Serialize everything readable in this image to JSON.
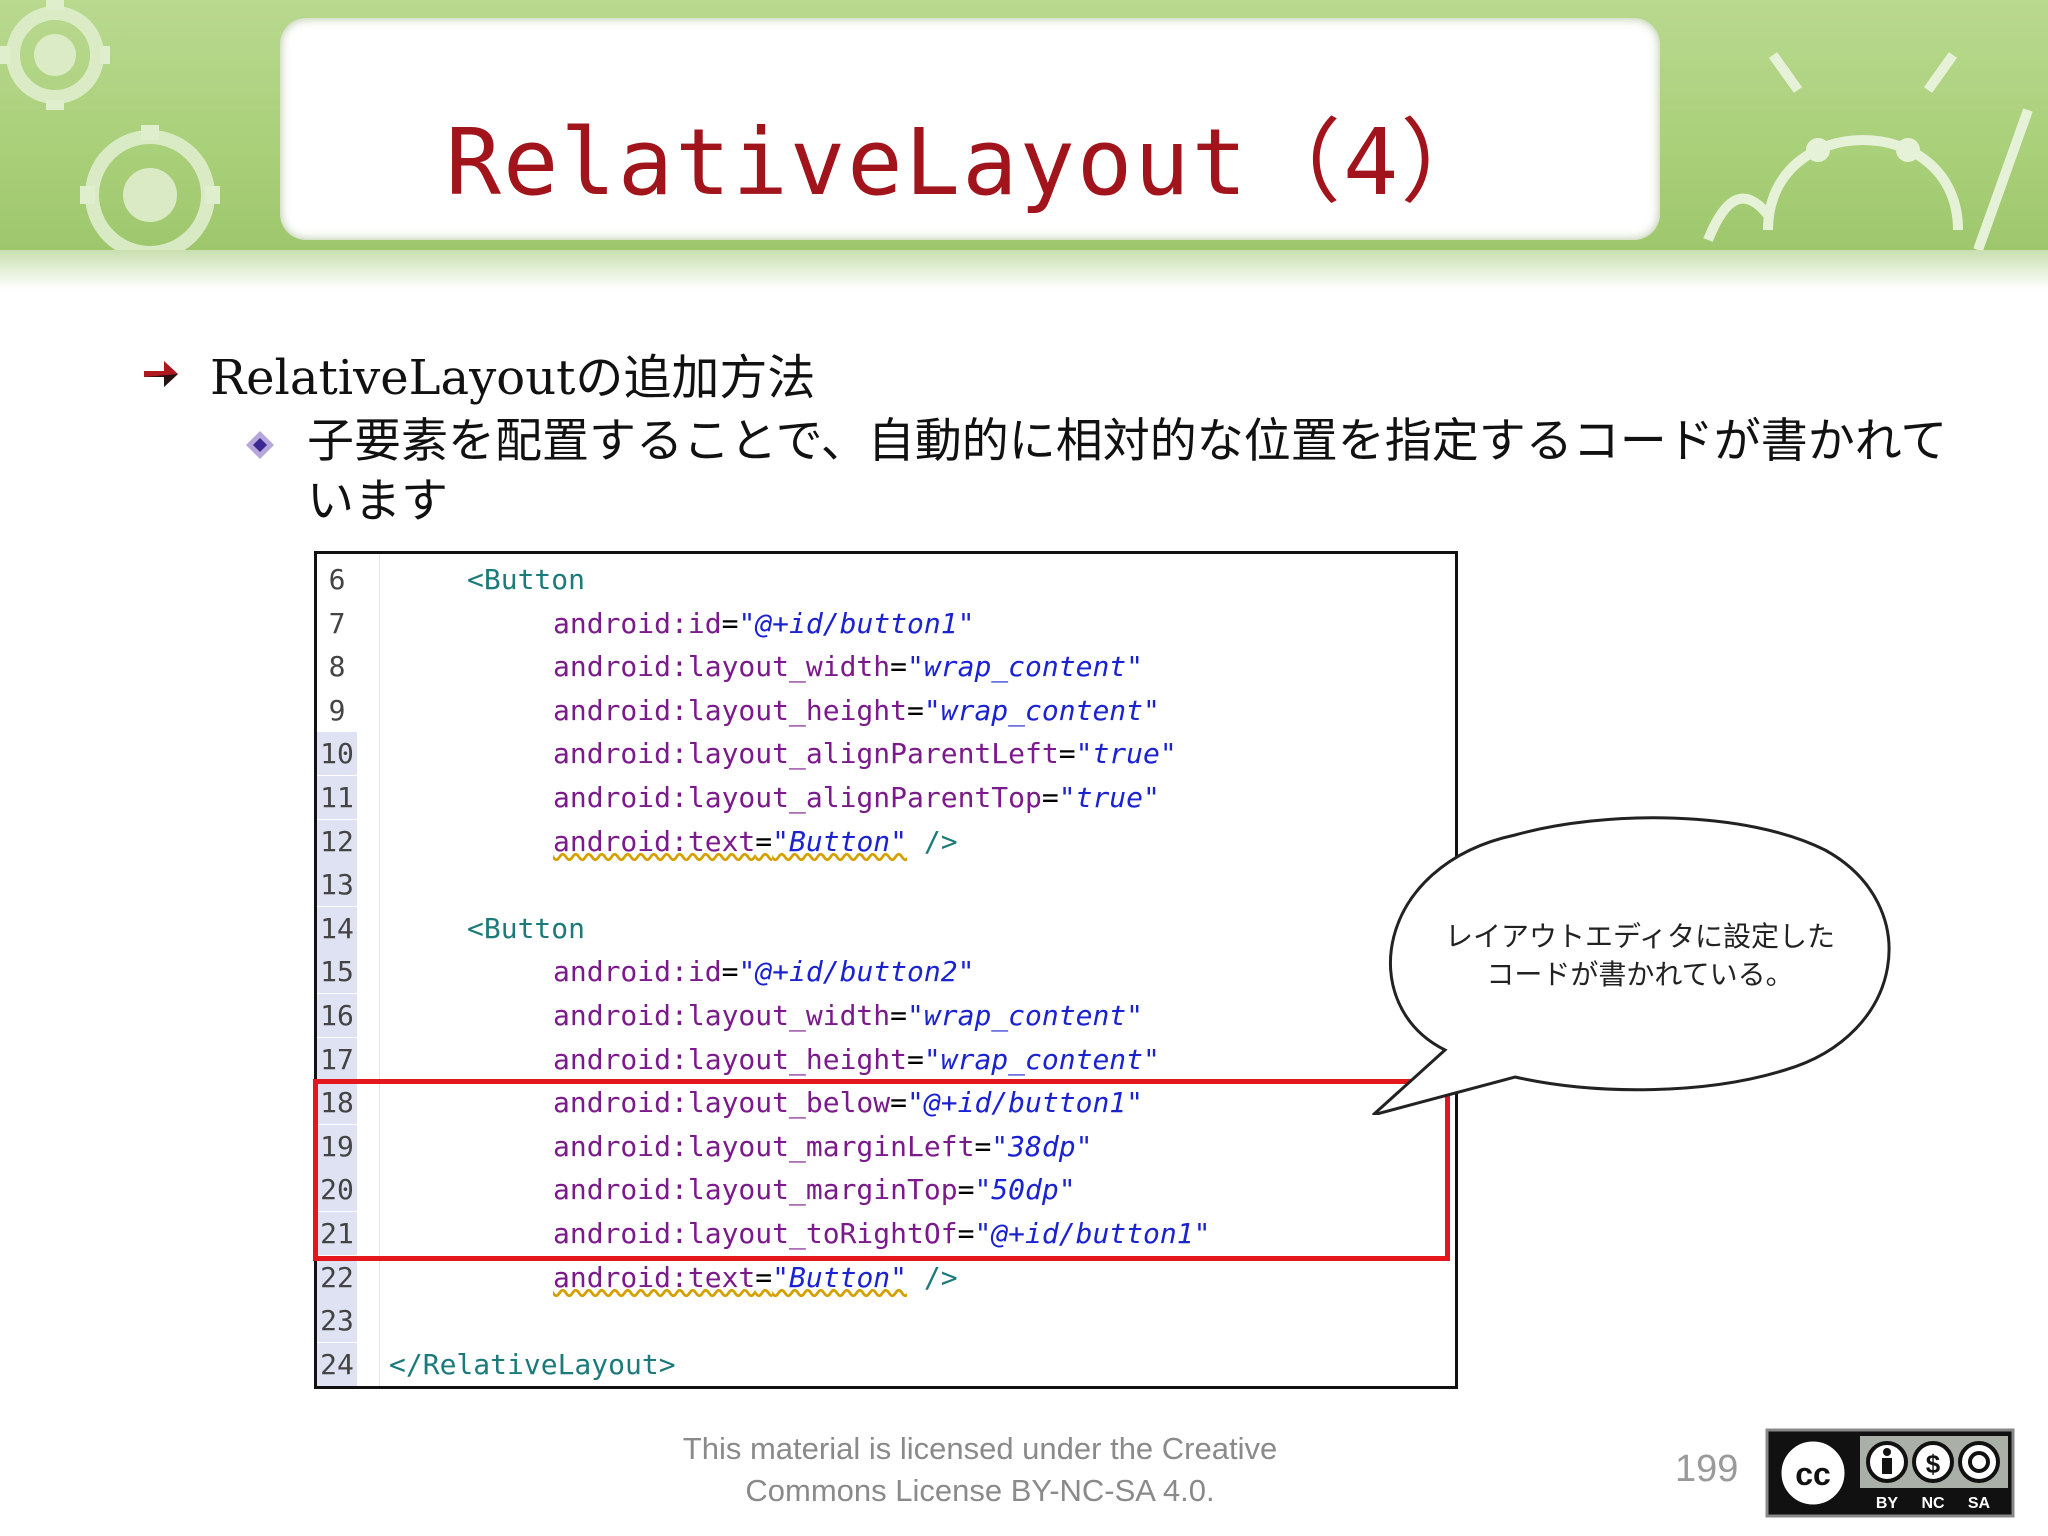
{
  "slide": {
    "title": "RelativeLayout（4）",
    "bullet1": "RelativeLayoutの追加方法",
    "bullet2": "子要素を配置することで、自動的に相対的な位置を指定するコードが書かれています"
  },
  "code": {
    "lines": [
      {
        "num": "6",
        "tag": "<Button"
      },
      {
        "num": "7",
        "attr": "android:id",
        "val": "\"@+id/button1\""
      },
      {
        "num": "8",
        "attr": "android:layout_width",
        "val": "\"wrap_content\""
      },
      {
        "num": "9",
        "attr": "android:layout_height",
        "val": "\"wrap_content\""
      },
      {
        "num": "10",
        "attr": "android:layout_alignParentLeft",
        "val": "\"true\""
      },
      {
        "num": "11",
        "attr": "android:layout_alignParentTop",
        "val": "\"true\""
      },
      {
        "num": "12",
        "attr": "android:text",
        "val": "\"Button\"",
        "close": " />"
      },
      {
        "num": "13"
      },
      {
        "num": "14",
        "tag": "<Button"
      },
      {
        "num": "15",
        "attr": "android:id",
        "val": "\"@+id/button2\""
      },
      {
        "num": "16",
        "attr": "android:layout_width",
        "val": "\"wrap_content\""
      },
      {
        "num": "17",
        "attr": "android:layout_height",
        "val": "\"wrap_content\""
      },
      {
        "num": "18",
        "attr": "android:layout_below",
        "val": "\"@+id/button1\""
      },
      {
        "num": "19",
        "attr": "android:layout_marginLeft",
        "val": "\"38dp\""
      },
      {
        "num": "20",
        "attr": "android:layout_marginTop",
        "val": "\"50dp\""
      },
      {
        "num": "21",
        "attr": "android:layout_toRightOf",
        "val": "\"@+id/button1\""
      },
      {
        "num": "22",
        "attr": "android:text",
        "val": "\"Button\"",
        "close": " />"
      },
      {
        "num": "23"
      },
      {
        "num": "24",
        "tag": "</RelativeLayout>"
      }
    ]
  },
  "callout": {
    "line1": "レイアウトエディタに設定した",
    "line2": "コードが書かれている。"
  },
  "footer": {
    "license_line1": "This material is licensed under the Creative",
    "license_line2": "Commons License BY-NC-SA 4.0.",
    "page_number": "199",
    "cc_labels": [
      "BY",
      "NC",
      "SA"
    ]
  },
  "colors": {
    "title": "#a1141b",
    "highlight_box": "#e3171c",
    "banner_green": "#a8cf78"
  }
}
